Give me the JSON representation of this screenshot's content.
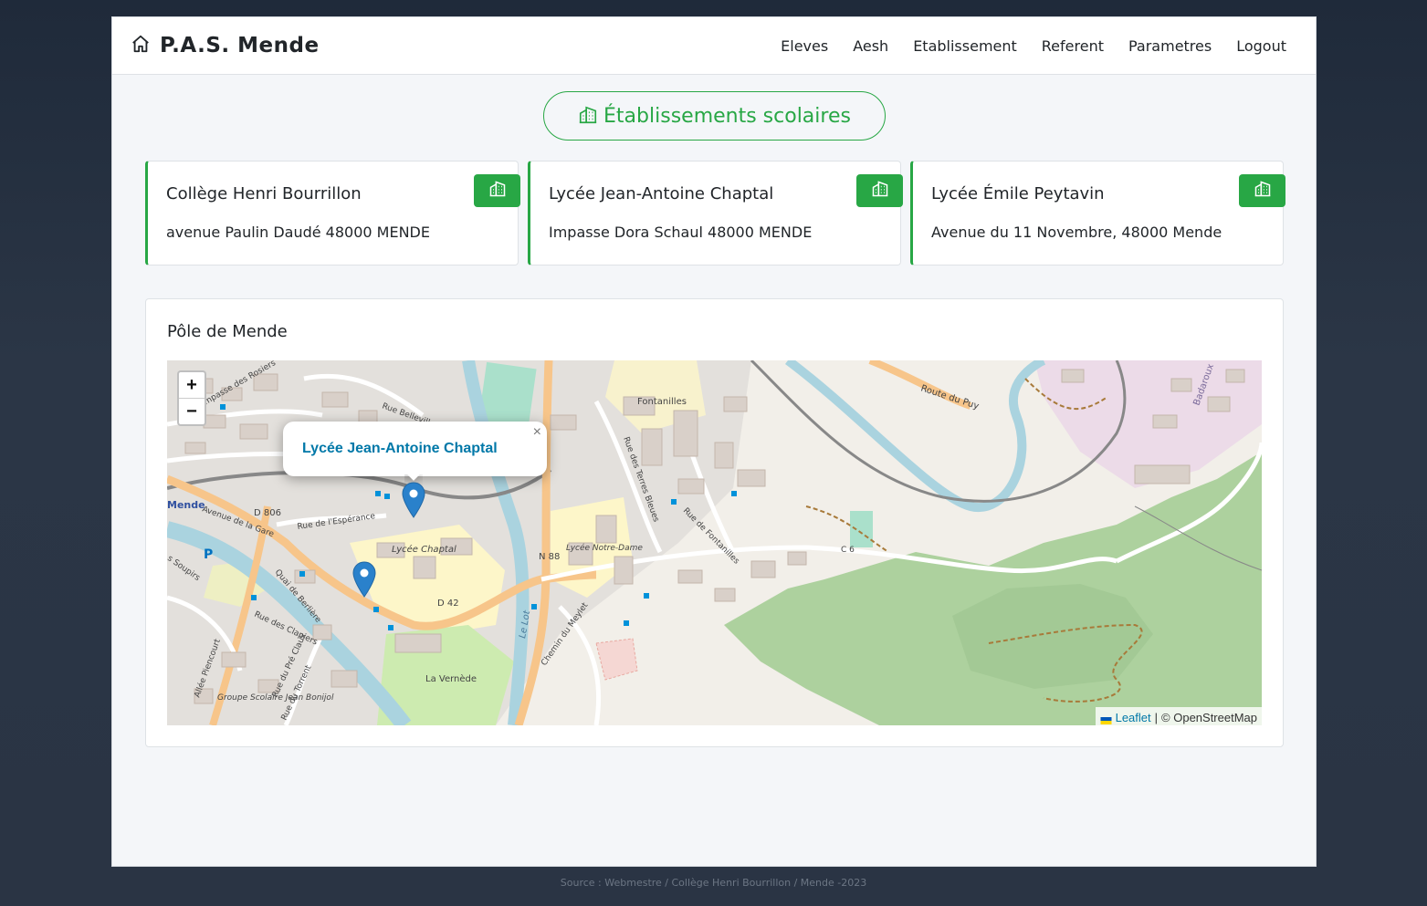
{
  "app": {
    "name": "P.A.S. Mende",
    "brand_icon": "home-icon"
  },
  "nav": {
    "items": [
      {
        "label": "Eleves"
      },
      {
        "label": "Aesh"
      },
      {
        "label": "Etablissement"
      },
      {
        "label": "Referent"
      },
      {
        "label": "Parametres"
      },
      {
        "label": "Logout"
      }
    ]
  },
  "page": {
    "title": "Établissements scolaires",
    "title_icon": "building-icon",
    "accent": "#28a745"
  },
  "schools": [
    {
      "name": "Collège Henri Bourrillon",
      "address": "avenue Paulin Daudé 48000 MENDE"
    },
    {
      "name": "Lycée Jean-Antoine Chaptal",
      "address": "Impasse Dora Schaul 48000 MENDE"
    },
    {
      "name": "Lycée Émile Peytavin",
      "address": "Avenue du 11 Novembre, 48000 Mende"
    }
  ],
  "map": {
    "title": "Pôle de Mende",
    "zoom_in": "+",
    "zoom_out": "−",
    "popup": {
      "title": "Lycée Jean-Antoine Chaptal",
      "close": "×"
    },
    "attribution": {
      "leaflet": "Leaflet",
      "separator": "|",
      "osm": "© OpenStreetMap"
    },
    "labels": {
      "fontanilles": "Fontanilles",
      "route_du_puy": "Route du Puy",
      "badaroux": "Badaroux",
      "rue_belleville": "Rue Belleville",
      "impasse_rosiers": "Impasse des Rosiers",
      "mende": "Mende",
      "avenue_gare": "Avenue de la Gare",
      "rue_esperance": "Rue de l'Espérance",
      "d806": "D 806",
      "lycee_chaptal": "Lycée Chaptal",
      "n88": "N 88",
      "lycee_notre_dame": "Lycée Notre-Dame",
      "d42": "D 42",
      "le_lot": "Le Lot",
      "la_vernede": "La Vernède",
      "chemin_meylet": "Chemin du Meylet",
      "quai_berlière": "Quai de Berlière",
      "rue_clapiers": "Rue des Clapiers",
      "rue_fontanilles": "Rue de Fontanilles",
      "rue_terres_bleues": "Rue des Terres Bleues",
      "c6": "C 6",
      "groupe_scolaire": "Groupe Scolaire Jean Bonijol",
      "allee_piencourt": "Allée Piencourt",
      "rue_pre_claux": "Rue du Pré Claux",
      "rue_torrent": "Rue du Torrent",
      "soupirs": "s Soupirs",
      "parking": "P"
    }
  },
  "footer": {
    "text": "Source : Webmestre / Collège Henri Bourrillon / Mende -2023"
  }
}
